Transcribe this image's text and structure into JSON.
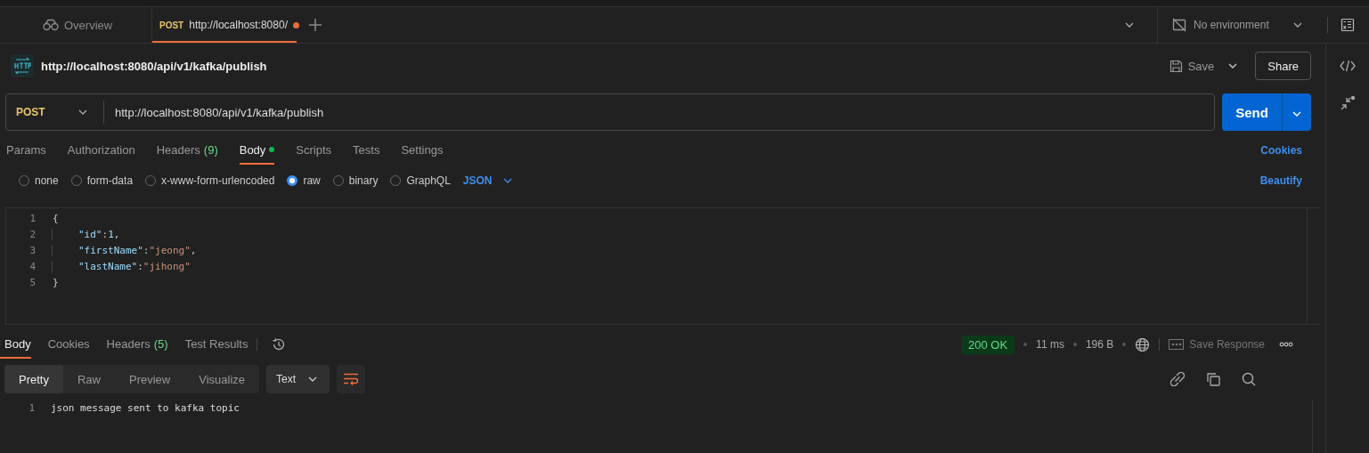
{
  "tabs": [
    {
      "kind": "overview",
      "label": "Overview",
      "selected": false
    },
    {
      "kind": "request",
      "method": "POST",
      "label": "http://localhost:8080/",
      "unsaved": true,
      "selected": true
    }
  ],
  "environment": {
    "label": "No environment"
  },
  "request": {
    "title": "http://localhost:8080/api/v1/kafka/publish",
    "save_label": "Save",
    "share_label": "Share",
    "method": "POST",
    "url": "http://localhost:8080/api/v1/kafka/publish",
    "send_label": "Send"
  },
  "request_tabs": [
    {
      "label": "Params",
      "selected": false
    },
    {
      "label": "Authorization",
      "selected": false
    },
    {
      "label": "Headers",
      "count": "(9)",
      "selected": false
    },
    {
      "label": "Body",
      "dot": true,
      "selected": true
    },
    {
      "label": "Scripts",
      "selected": false
    },
    {
      "label": "Tests",
      "selected": false
    },
    {
      "label": "Settings",
      "selected": false
    }
  ],
  "cookies_link": "Cookies",
  "body_modes": [
    {
      "label": "none",
      "selected": false
    },
    {
      "label": "form-data",
      "selected": false
    },
    {
      "label": "x-www-form-urlencoded",
      "selected": false
    },
    {
      "label": "raw",
      "selected": true
    },
    {
      "label": "binary",
      "selected": false
    },
    {
      "label": "GraphQL",
      "selected": false
    }
  ],
  "body_format": "JSON",
  "beautify_label": "Beautify",
  "body_lines": [
    {
      "number": "1",
      "indented": false,
      "tokens": [
        {
          "kind": "punct",
          "text": "{"
        }
      ]
    },
    {
      "number": "2",
      "indented": true,
      "tokens": [
        {
          "kind": "key",
          "text": "\"id\""
        },
        {
          "kind": "punct",
          "text": ":"
        },
        {
          "kind": "number",
          "text": "1"
        },
        {
          "kind": "punct",
          "text": ","
        }
      ]
    },
    {
      "number": "3",
      "indented": true,
      "tokens": [
        {
          "kind": "key",
          "text": "\"firstName\""
        },
        {
          "kind": "punct",
          "text": ":"
        },
        {
          "kind": "string",
          "text": "\"jeong\""
        },
        {
          "kind": "punct",
          "text": ","
        }
      ]
    },
    {
      "number": "4",
      "indented": true,
      "tokens": [
        {
          "kind": "key",
          "text": "\"lastName\""
        },
        {
          "kind": "punct",
          "text": ":"
        },
        {
          "kind": "string",
          "text": "\"jihong\""
        }
      ]
    },
    {
      "number": "5",
      "indented": false,
      "tokens": [
        {
          "kind": "punct",
          "text": "}"
        }
      ]
    }
  ],
  "response": {
    "tabs": [
      {
        "label": "Body",
        "selected": true
      },
      {
        "label": "Cookies",
        "selected": false
      },
      {
        "label": "Headers",
        "count": "(5)",
        "selected": false
      },
      {
        "label": "Test Results",
        "selected": false
      }
    ],
    "status": "200 OK",
    "time": "11 ms",
    "size": "196 B",
    "save_label": "Save Response",
    "view_modes": [
      {
        "label": "Pretty",
        "selected": true
      },
      {
        "label": "Raw",
        "selected": false
      },
      {
        "label": "Preview",
        "selected": false
      },
      {
        "label": "Visualize",
        "selected": false
      }
    ],
    "format": "Text",
    "lines": [
      {
        "number": "1",
        "text": "json message sent to kafka topic"
      }
    ]
  }
}
